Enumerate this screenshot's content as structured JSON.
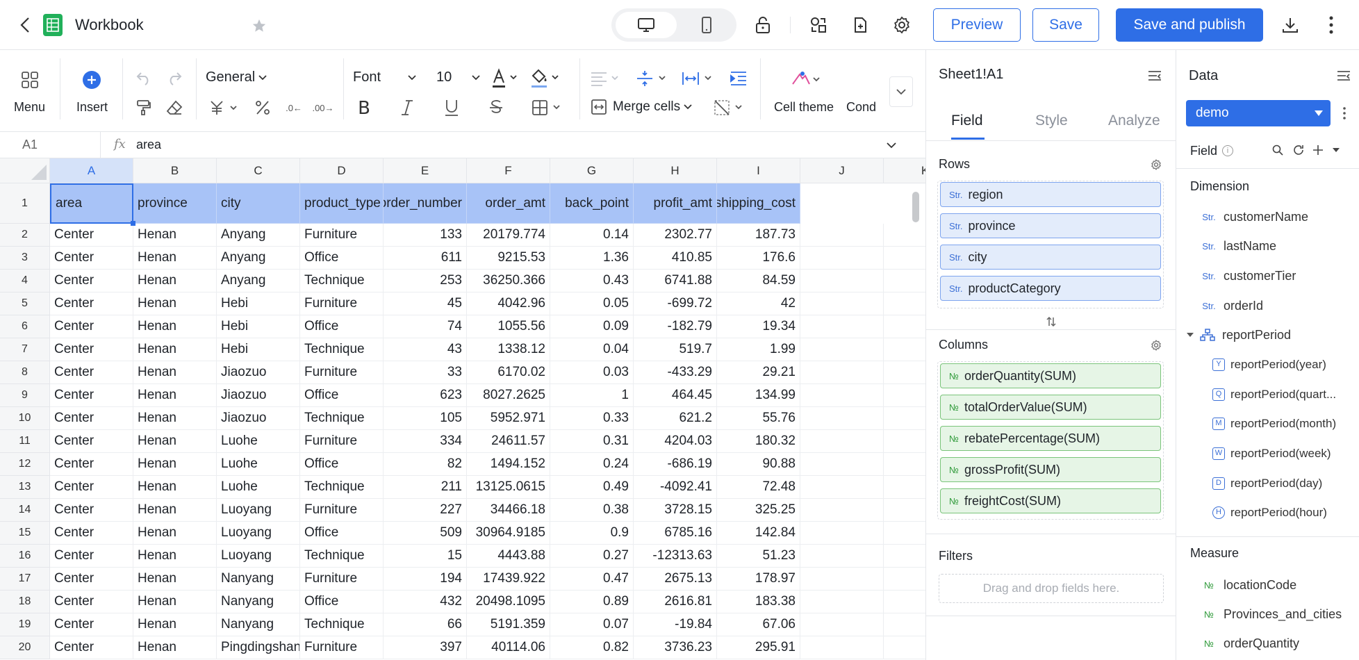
{
  "app": {
    "title": "Workbook"
  },
  "actions": {
    "preview": "Preview",
    "save": "Save",
    "publish": "Save and publish"
  },
  "ribbon": {
    "menu": "Menu",
    "insert": "Insert",
    "format": "General",
    "font": "Font",
    "font_size": "10",
    "merge": "Merge cells",
    "cell_theme": "Cell theme",
    "cond": "Cond"
  },
  "formula": {
    "ref": "A1",
    "fx": "fx",
    "value": "area"
  },
  "columns": [
    "A",
    "B",
    "C",
    "D",
    "E",
    "F",
    "G",
    "H",
    "I",
    "J",
    "K"
  ],
  "header_row": [
    "area",
    "province",
    "city",
    "product_type",
    "order_number",
    "order_amt",
    "back_point",
    "profit_amt",
    "shipping_cost"
  ],
  "rows": [
    [
      "Center",
      "Henan",
      "Anyang",
      "Furniture",
      "133",
      "20179.774",
      "0.14",
      "2302.77",
      "187.73"
    ],
    [
      "Center",
      "Henan",
      "Anyang",
      "Office",
      "611",
      "9215.53",
      "1.36",
      "410.85",
      "176.6"
    ],
    [
      "Center",
      "Henan",
      "Anyang",
      "Technique",
      "253",
      "36250.366",
      "0.43",
      "6741.88",
      "84.59"
    ],
    [
      "Center",
      "Henan",
      "Hebi",
      "Furniture",
      "45",
      "4042.96",
      "0.05",
      "-699.72",
      "42"
    ],
    [
      "Center",
      "Henan",
      "Hebi",
      "Office",
      "74",
      "1055.56",
      "0.09",
      "-182.79",
      "19.34"
    ],
    [
      "Center",
      "Henan",
      "Hebi",
      "Technique",
      "43",
      "1338.12",
      "0.04",
      "519.7",
      "1.99"
    ],
    [
      "Center",
      "Henan",
      "Jiaozuo",
      "Furniture",
      "33",
      "6170.02",
      "0.03",
      "-433.29",
      "29.21"
    ],
    [
      "Center",
      "Henan",
      "Jiaozuo",
      "Office",
      "623",
      "8027.2625",
      "1",
      "464.45",
      "134.99"
    ],
    [
      "Center",
      "Henan",
      "Jiaozuo",
      "Technique",
      "105",
      "5952.971",
      "0.33",
      "621.2",
      "55.76"
    ],
    [
      "Center",
      "Henan",
      "Luohe",
      "Furniture",
      "334",
      "24611.57",
      "0.31",
      "4204.03",
      "180.32"
    ],
    [
      "Center",
      "Henan",
      "Luohe",
      "Office",
      "82",
      "1494.152",
      "0.24",
      "-686.19",
      "90.88"
    ],
    [
      "Center",
      "Henan",
      "Luohe",
      "Technique",
      "211",
      "13125.0615",
      "0.49",
      "-4092.41",
      "72.48"
    ],
    [
      "Center",
      "Henan",
      "Luoyang",
      "Furniture",
      "227",
      "34466.18",
      "0.38",
      "3728.15",
      "325.25"
    ],
    [
      "Center",
      "Henan",
      "Luoyang",
      "Office",
      "509",
      "30964.9185",
      "0.9",
      "6785.16",
      "142.84"
    ],
    [
      "Center",
      "Henan",
      "Luoyang",
      "Technique",
      "15",
      "4443.88",
      "0.27",
      "-12313.63",
      "51.23"
    ],
    [
      "Center",
      "Henan",
      "Nanyang",
      "Furniture",
      "194",
      "17439.922",
      "0.47",
      "2675.13",
      "178.97"
    ],
    [
      "Center",
      "Henan",
      "Nanyang",
      "Office",
      "432",
      "20498.1095",
      "0.89",
      "2616.81",
      "183.38"
    ],
    [
      "Center",
      "Henan",
      "Nanyang",
      "Technique",
      "66",
      "5191.359",
      "0.07",
      "-19.84",
      "67.06"
    ],
    [
      "Center",
      "Henan",
      "Pingdingshan",
      "Furniture",
      "397",
      "40114.06",
      "0.82",
      "3736.23",
      "295.91"
    ]
  ],
  "panel": {
    "cell_ref": "Sheet1!A1",
    "tabs": [
      "Field",
      "Style",
      "Analyze"
    ],
    "rows_label": "Rows",
    "row_fields": [
      "region",
      "province",
      "city",
      "productCategory"
    ],
    "columns_label": "Columns",
    "column_fields": [
      "orderQuantity(SUM)",
      "totalOrderValue(SUM)",
      "rebatePercentage(SUM)",
      "grossProfit(SUM)",
      "freightCost(SUM)"
    ],
    "filters_label": "Filters",
    "filters_placeholder": "Drag and drop fields here."
  },
  "data_panel": {
    "title": "Data",
    "dataset": "demo",
    "field_label": "Field",
    "dimension_label": "Dimension",
    "dimensions": [
      "customerName",
      "lastName",
      "customerTier",
      "orderId"
    ],
    "group": "reportPeriod",
    "periods": [
      {
        "tag": "Y",
        "label": "reportPeriod(year)"
      },
      {
        "tag": "Q",
        "label": "reportPeriod(quart..."
      },
      {
        "tag": "M",
        "label": "reportPeriod(month)"
      },
      {
        "tag": "W",
        "label": "reportPeriod(week)"
      },
      {
        "tag": "D",
        "label": "reportPeriod(day)"
      },
      {
        "tag": "H",
        "label": "reportPeriod(hour)"
      }
    ],
    "measure_label": "Measure",
    "measures": [
      "locationCode",
      "Provinces_and_cities",
      "orderQuantity"
    ]
  },
  "colors": {
    "accent": "#2e6ee6",
    "selection": "#a8c3f7"
  }
}
